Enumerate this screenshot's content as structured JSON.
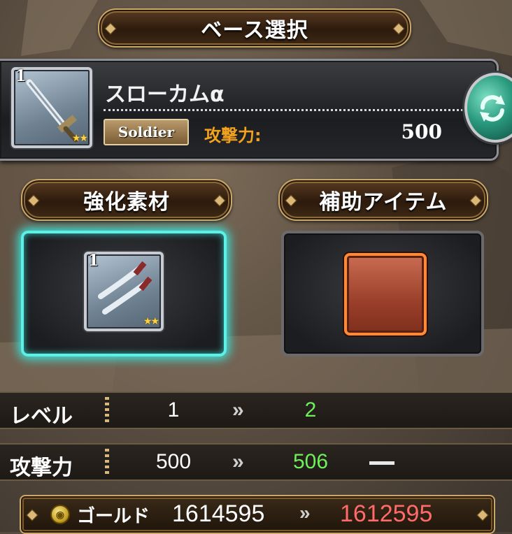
{
  "header": {
    "title": "ベース選択"
  },
  "base": {
    "level_badge": "1",
    "stars": "★★",
    "name": "スローカムα",
    "class": "Soldier",
    "attack_label": "攻撃力:",
    "attack_value": "500",
    "refresh_icon": "refresh-icon"
  },
  "sections": {
    "material_title": "強化素材",
    "support_title": "補助アイテム"
  },
  "material": {
    "level_badge": "1",
    "stars": "★★",
    "icon": "twin-daggers-icon"
  },
  "support": {
    "state": "empty"
  },
  "stats": [
    {
      "label": "レベル",
      "from": "1",
      "arrow": "»",
      "to": "2"
    },
    {
      "label": "攻撃力",
      "from": "500",
      "arrow": "»",
      "to": "506",
      "extra": "—"
    }
  ],
  "gold": {
    "label": "ゴールド",
    "from": "1614595",
    "arrow": "»",
    "to": "1612595",
    "coin_glyph": "◉"
  },
  "colors": {
    "highlight_cyan": "#5ef0e6",
    "increase_green": "#6ef05a",
    "decrease_red": "#ff6a6a",
    "attack_orange": "#f2a21c"
  }
}
